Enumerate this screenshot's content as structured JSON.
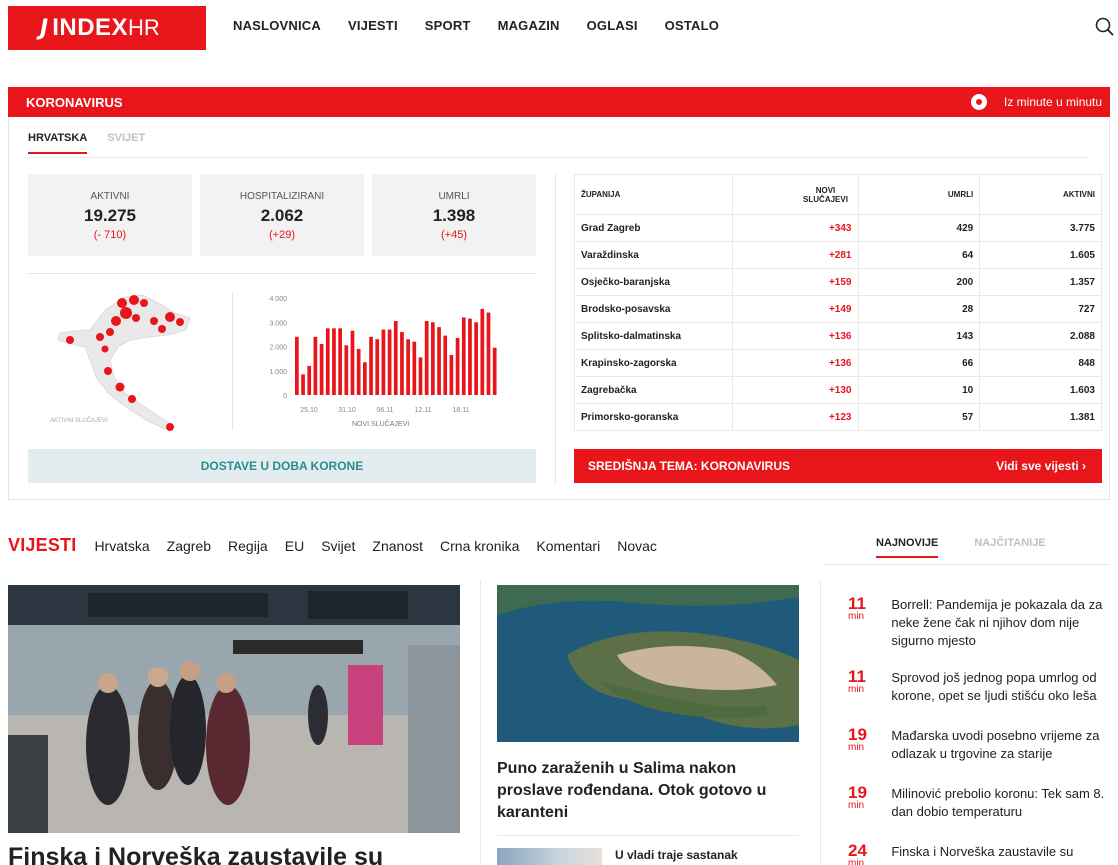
{
  "header": {
    "logo_text": "INDEX",
    "logo_hr": "HR",
    "nav": [
      "NASLOVNICA",
      "VIJESTI",
      "SPORT",
      "MAGAZIN",
      "OGLASI",
      "OSTALO"
    ]
  },
  "corona": {
    "title": "KORONAVIRUS",
    "live_label": "Iz minute u minutu",
    "tabs": [
      "HRVATSKA",
      "SVIJET"
    ],
    "stats": [
      {
        "label": "AKTIVNI",
        "value": "19.275",
        "diff": "(- 710)"
      },
      {
        "label": "HOSPITALIZIRANI",
        "value": "2.062",
        "diff": "(+29)"
      },
      {
        "label": "UMRLI",
        "value": "1.398",
        "diff": "(+45)"
      }
    ],
    "map_label": "AKTIVNI SLUČAJEVI",
    "dostave_label": "DOSTAVE U DOBA KORONE",
    "table": {
      "headers": [
        "ŽUPANIJA",
        "NOVI SLUČAJEVI",
        "UMRLI",
        "AKTIVNI"
      ],
      "rows": [
        [
          "Grad Zagreb",
          "+343",
          "429",
          "3.775"
        ],
        [
          "Varaždinska",
          "+281",
          "64",
          "1.605"
        ],
        [
          "Osječko-baranjska",
          "+159",
          "200",
          "1.357"
        ],
        [
          "Brodsko-posavska",
          "+149",
          "28",
          "727"
        ],
        [
          "Splitsko-dalmatinska",
          "+136",
          "143",
          "2.088"
        ],
        [
          "Krapinsko-zagorska",
          "+136",
          "66",
          "848"
        ],
        [
          "Zagrebačka",
          "+130",
          "10",
          "1.603"
        ],
        [
          "Primorsko-goranska",
          "+123",
          "57",
          "1.381"
        ]
      ]
    },
    "sredisnja_label": "SREDIŠNJA TEMA: KORONAVIRUS",
    "sredisnja_more": "Vidi sve vijesti  ›"
  },
  "chart_data": {
    "type": "bar",
    "xlabel": "NOVI SLUČAJEVI",
    "ylim": [
      0,
      4000
    ],
    "yticks": [
      "4.000",
      "3.000",
      "2.000",
      "1.000",
      "0"
    ],
    "xticks": [
      "25.10",
      "31.10",
      "06.11",
      "12.11",
      "18.11"
    ],
    "values": [
      2400,
      850,
      1200,
      2400,
      2100,
      2750,
      2750,
      2750,
      2050,
      2650,
      1900,
      1350,
      2400,
      2300,
      2700,
      2700,
      3050,
      2600,
      2300,
      2200,
      1550,
      3050,
      3000,
      2800,
      2450,
      1650,
      2350,
      3200,
      3150,
      3000,
      3550,
      3400,
      1950
    ],
    "color": "#e8151b"
  },
  "news": {
    "section_title": "VIJESTI",
    "categories": [
      "Hrvatska",
      "Zagreb",
      "Regija",
      "EU",
      "Svijet",
      "Znanost",
      "Crna kronika",
      "Komentari",
      "Novac"
    ],
    "latest_tabs": [
      "NAJNOVIJE",
      "NAJČITANIJE"
    ],
    "main_headline": "Finska i Norveška zaustavile su",
    "mid_headline": "Puno zaraženih u Salima nakon proslave rođendana. Otok gotovo u karanteni",
    "small_headline": "U vladi traje sastanak",
    "latest": [
      {
        "time": "11",
        "unit": "min",
        "text": "Borrell: Pandemija je pokazala da za neke žene čak ni njihov dom nije sigurno mjesto"
      },
      {
        "time": "11",
        "unit": "min",
        "text": "Sprovod još jednog popa umrlog od korone, opet se ljudi stišću oko leša"
      },
      {
        "time": "19",
        "unit": "min",
        "text": "Mađarska uvodi posebno vrijeme za odlazak u trgovine za starije"
      },
      {
        "time": "19",
        "unit": "min",
        "text": "Milinović prebolio koronu: Tek sam 8. dan dobio temperaturu"
      },
      {
        "time": "24",
        "unit": "min",
        "text": "Finska i Norveška zaustavile su"
      }
    ]
  },
  "colors": {
    "brand_red": "#e8151b",
    "teal": "#2a8d8c",
    "teal_bg": "#e3edf0"
  }
}
